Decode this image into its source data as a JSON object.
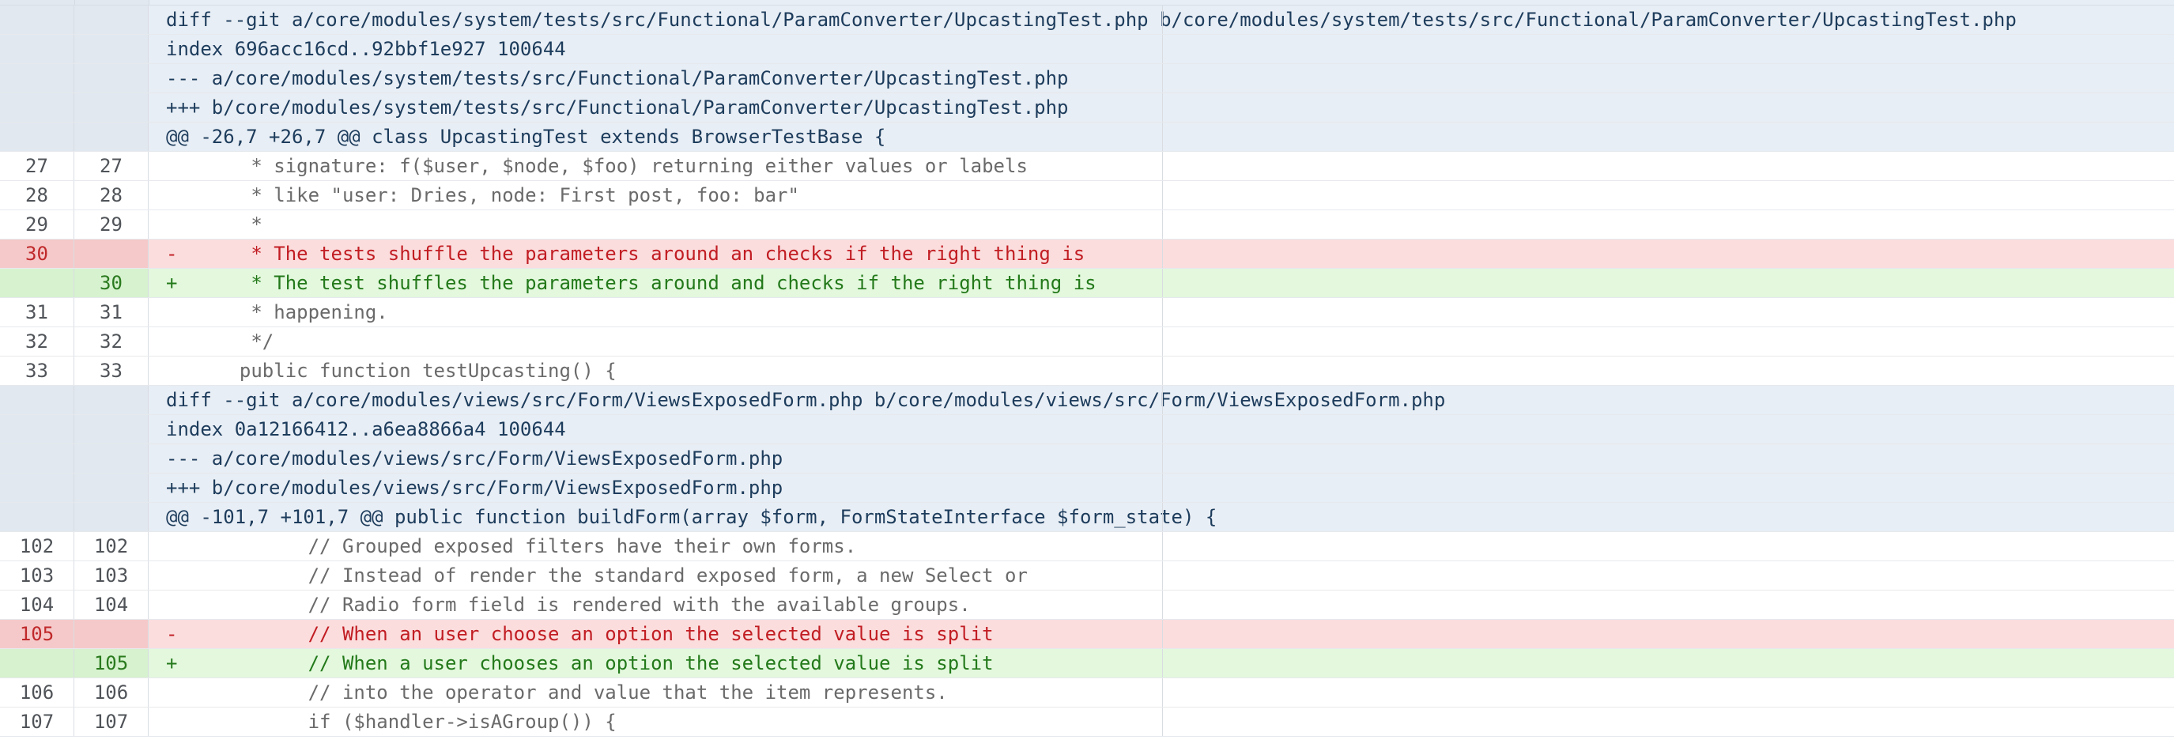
{
  "rows": [
    {
      "type": "header",
      "old": "",
      "new": "",
      "marker": "",
      "text": "diff --git a/core/modules/system/tests/src/Functional/ParamConverter/UpcastingTest.php b/core/modules/system/tests/src/Functional/ParamConverter/UpcastingTest.php"
    },
    {
      "type": "header",
      "old": "",
      "new": "",
      "marker": "",
      "text": "index 696acc16cd..92bbf1e927 100644"
    },
    {
      "type": "header",
      "old": "",
      "new": "",
      "marker": "",
      "text": "--- a/core/modules/system/tests/src/Functional/ParamConverter/UpcastingTest.php"
    },
    {
      "type": "header",
      "old": "",
      "new": "",
      "marker": "",
      "text": "+++ b/core/modules/system/tests/src/Functional/ParamConverter/UpcastingTest.php"
    },
    {
      "type": "header",
      "old": "",
      "new": "",
      "marker": "",
      "text": "@@ -26,7 +26,7 @@ class UpcastingTest extends BrowserTestBase {"
    },
    {
      "type": "context",
      "old": "27",
      "new": "27",
      "marker": "",
      "text": "   * signature: f($user, $node, $foo) returning either values or labels"
    },
    {
      "type": "context",
      "old": "28",
      "new": "28",
      "marker": "",
      "text": "   * like \"user: Dries, node: First post, foo: bar\""
    },
    {
      "type": "context",
      "old": "29",
      "new": "29",
      "marker": "",
      "text": "   *"
    },
    {
      "type": "del",
      "old": "30",
      "new": "",
      "marker": "-",
      "text": "   * The tests shuffle the parameters around an checks if the right thing is"
    },
    {
      "type": "add",
      "old": "",
      "new": "30",
      "marker": "+",
      "text": "   * The test shuffles the parameters around and checks if the right thing is"
    },
    {
      "type": "context",
      "old": "31",
      "new": "31",
      "marker": "",
      "text": "   * happening."
    },
    {
      "type": "context",
      "old": "32",
      "new": "32",
      "marker": "",
      "text": "   */"
    },
    {
      "type": "context",
      "old": "33",
      "new": "33",
      "marker": "",
      "text": "  public function testUpcasting() {"
    },
    {
      "type": "header",
      "old": "",
      "new": "",
      "marker": "",
      "text": "diff --git a/core/modules/views/src/Form/ViewsExposedForm.php b/core/modules/views/src/Form/ViewsExposedForm.php"
    },
    {
      "type": "header",
      "old": "",
      "new": "",
      "marker": "",
      "text": "index 0a12166412..a6ea8866a4 100644"
    },
    {
      "type": "header",
      "old": "",
      "new": "",
      "marker": "",
      "text": "--- a/core/modules/views/src/Form/ViewsExposedForm.php"
    },
    {
      "type": "header",
      "old": "",
      "new": "",
      "marker": "",
      "text": "+++ b/core/modules/views/src/Form/ViewsExposedForm.php"
    },
    {
      "type": "header",
      "old": "",
      "new": "",
      "marker": "",
      "text": "@@ -101,7 +101,7 @@ public function buildForm(array $form, FormStateInterface $form_state) {"
    },
    {
      "type": "context",
      "old": "102",
      "new": "102",
      "marker": "",
      "text": "        // Grouped exposed filters have their own forms."
    },
    {
      "type": "context",
      "old": "103",
      "new": "103",
      "marker": "",
      "text": "        // Instead of render the standard exposed form, a new Select or"
    },
    {
      "type": "context",
      "old": "104",
      "new": "104",
      "marker": "",
      "text": "        // Radio form field is rendered with the available groups."
    },
    {
      "type": "del",
      "old": "105",
      "new": "",
      "marker": "-",
      "text": "        // When an user choose an option the selected value is split"
    },
    {
      "type": "add",
      "old": "",
      "new": "105",
      "marker": "+",
      "text": "        // When a user chooses an option the selected value is split"
    },
    {
      "type": "context",
      "old": "106",
      "new": "106",
      "marker": "",
      "text": "        // into the operator and value that the item represents."
    },
    {
      "type": "context",
      "old": "107",
      "new": "107",
      "marker": "",
      "text": "        if ($handler->isAGroup()) {"
    }
  ]
}
